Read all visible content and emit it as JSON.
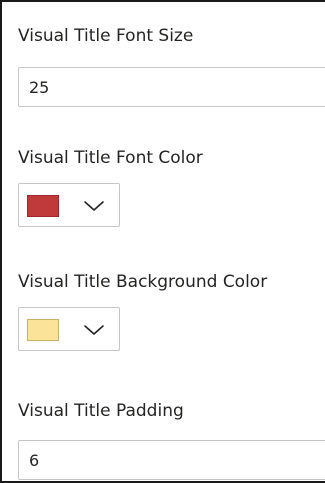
{
  "fields": {
    "font_size": {
      "label": "Visual Title Font Size",
      "value": "25"
    },
    "font_color": {
      "label": "Visual Title Font Color",
      "swatch_color": "#c0393b",
      "swatch_border": "#9e2a2d",
      "icon": "chevron-down-icon"
    },
    "background_color": {
      "label": "Visual Title Background Color",
      "swatch_color": "#fbe49a",
      "swatch_border": "#c9b06a",
      "icon": "chevron-down-icon"
    },
    "padding": {
      "label": "Visual Title Padding",
      "value": "6"
    }
  }
}
